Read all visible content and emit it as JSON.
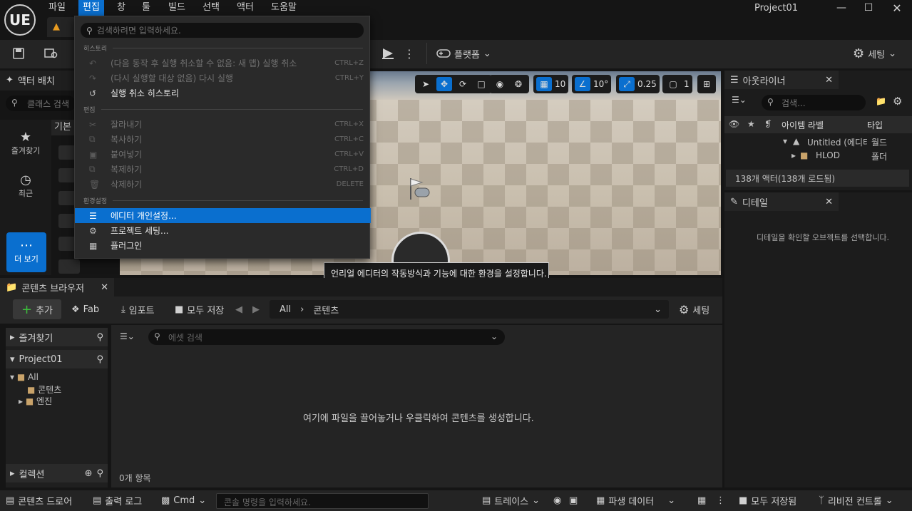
{
  "app": {
    "logo": "UE",
    "project_name": "Project01"
  },
  "menubar": [
    "파일",
    "편집",
    "창",
    "툴",
    "빌드",
    "선택",
    "액터",
    "도움말"
  ],
  "toolbar": {
    "platform_label": "플랫폼",
    "settings_label": "세팅"
  },
  "place_actors": {
    "title": "액터 배치",
    "search_placeholder": "클래스 검색",
    "basic_tab": "기본",
    "categories": [
      {
        "label": "즐겨찾기",
        "icon": "star-icon"
      },
      {
        "label": "최근",
        "icon": "clock-icon"
      }
    ],
    "more_label": "더 보기"
  },
  "viewport": {
    "grid_value": "10",
    "rotation_value": "10°",
    "scale_value": "0.25",
    "camera_speed": "1"
  },
  "tooltip": "언리얼 에디터의 작동방식과 기능에 대한 환경을 설정합니다.",
  "outliner": {
    "title": "아웃라이너",
    "search_placeholder": "검색...",
    "columns": [
      "아이템 라벨",
      "타입"
    ],
    "rows": [
      {
        "label": "Untitled (에디터",
        "type": "월드"
      },
      {
        "label": "HLOD",
        "type": "폴더"
      }
    ],
    "status": "138개 액터(138개 로드됨)"
  },
  "details": {
    "title": "디테일",
    "empty_msg": "디테일을 확인할 오브젝트를 선택합니다."
  },
  "content_browser": {
    "title": "콘텐츠 브라우저",
    "add_label": "추가",
    "fab_label": "Fab",
    "import_label": "임포트",
    "save_all_label": "모두 저장",
    "path_root": "All",
    "path_current": "콘텐츠",
    "settings_label": "세팅",
    "favorites_label": "즐겨찾기",
    "project_label": "Project01",
    "tree": [
      {
        "label": "All"
      },
      {
        "label": "콘텐츠"
      },
      {
        "label": "엔진"
      }
    ],
    "collections_label": "컬렉션",
    "asset_search_placeholder": "에셋 검색",
    "empty_msg": "여기에 파일을 끌어놓거나 우클릭하여 콘텐츠를 생성합니다.",
    "item_count": "0개 항목"
  },
  "statusbar": {
    "drawer_label": "콘텐츠 드로어",
    "output_log_label": "출력 로그",
    "cmd_label": "Cmd",
    "console_placeholder": "콘솔 명령을 입력하세요.",
    "trace_label": "트레이스",
    "derived_data_label": "파생 데이터",
    "save_all_label": "모두 저장됨",
    "revision_label": "리비전 컨트롤"
  },
  "edit_menu": {
    "search_placeholder": "검색하려면 입력하세요.",
    "sections": [
      "히스토리",
      "편집",
      "환경설정"
    ],
    "history_items": [
      {
        "label": "(다음 동작 후 실행 취소할 수 없음: 새 맵) 실행 취소",
        "shortcut": "CTRL+Z",
        "icon": "undo-icon"
      },
      {
        "label": "(다시 실행할 대상 없음) 다시 실행",
        "shortcut": "CTRL+Y",
        "icon": "redo-icon"
      },
      {
        "label": "실행 취소 히스토리",
        "shortcut": "",
        "icon": "history-icon"
      }
    ],
    "edit_items": [
      {
        "label": "잘라내기",
        "shortcut": "CTRL+X",
        "icon": "cut-icon"
      },
      {
        "label": "복사하기",
        "shortcut": "CTRL+C",
        "icon": "copy-icon"
      },
      {
        "label": "붙여넣기",
        "shortcut": "CTRL+V",
        "icon": "paste-icon"
      },
      {
        "label": "복제하기",
        "shortcut": "CTRL+D",
        "icon": "duplicate-icon"
      },
      {
        "label": "삭제하기",
        "shortcut": "DELETE",
        "icon": "delete-icon"
      }
    ],
    "pref_items": [
      {
        "label": "에디터 개인설정...",
        "icon": "sliders-icon"
      },
      {
        "label": "프로젝트 세팅...",
        "icon": "project-settings-icon"
      },
      {
        "label": "플러그인",
        "icon": "plugin-icon"
      }
    ]
  }
}
